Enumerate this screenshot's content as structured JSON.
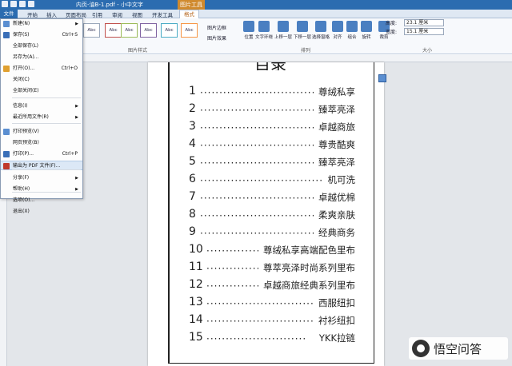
{
  "titlebar": {
    "doc_title": "内页-油B-1.pdf - 小中文字",
    "picture_tools": "图片工具"
  },
  "tabs": {
    "file": "文件",
    "start": "开始",
    "insert": "插入",
    "layout": "页面布局",
    "reference": "引用",
    "review": "审阅",
    "view": "视图",
    "developer": "开发工具",
    "format": "格式"
  },
  "ribbon": {
    "style_label": "Abc",
    "picture_border": "图片边框",
    "picture_effect": "图片效果",
    "group_picture_style": "图片样式",
    "position": "位置",
    "wrap_text": "文字环绕",
    "bring_forward": "上移一层",
    "send_backward": "下移一层",
    "selection_pane": "选择窗格",
    "align": "对齐",
    "group": "组合",
    "rotate": "旋转",
    "crop": "裁剪",
    "group_arrange": "排列",
    "height_label": "高度:",
    "height_value": "23.1 厘米",
    "width_label": "宽度:",
    "width_value": "15.1 厘米",
    "group_size": "大小"
  },
  "file_menu": {
    "items": [
      {
        "label": "新建(N)",
        "shortcut": "",
        "arrow": "▶"
      },
      {
        "label": "保存(S)",
        "shortcut": "Ctrl+S",
        "arrow": ""
      },
      {
        "label": "全部保存(L)",
        "shortcut": "",
        "arrow": ""
      },
      {
        "label": "另存为(A)...",
        "shortcut": "",
        "arrow": ""
      },
      {
        "label": "打开(O)...",
        "shortcut": "Ctrl+O",
        "arrow": ""
      },
      {
        "label": "关闭(C)",
        "shortcut": "",
        "arrow": ""
      },
      {
        "label": "全部关闭(E)",
        "shortcut": "",
        "arrow": ""
      },
      {
        "label": "信息(I)",
        "shortcut": "",
        "arrow": "▶"
      },
      {
        "label": "最近所用文件(R)",
        "shortcut": "",
        "arrow": "▶"
      },
      {
        "label": "打印预览(V)",
        "shortcut": "",
        "arrow": ""
      },
      {
        "label": "网页预览(B)",
        "shortcut": "",
        "arrow": ""
      },
      {
        "label": "打印(P)...",
        "shortcut": "Ctrl+P",
        "arrow": ""
      },
      {
        "label": "输出为 PDF 文件(F)...",
        "shortcut": "",
        "arrow": ""
      },
      {
        "label": "分享(F)",
        "shortcut": "",
        "arrow": "▶"
      },
      {
        "label": "帮助(H)",
        "shortcut": "",
        "arrow": "▶"
      },
      {
        "label": "选项(O)...",
        "shortcut": "",
        "arrow": ""
      },
      {
        "label": "退出(X)",
        "shortcut": "",
        "arrow": ""
      }
    ]
  },
  "document": {
    "title": "目录",
    "entries": [
      {
        "num": "1",
        "text": "尊绒私享"
      },
      {
        "num": "2",
        "text": "臻萃亮泽"
      },
      {
        "num": "3",
        "text": "卓越商旅"
      },
      {
        "num": "4",
        "text": "尊贵酷爽"
      },
      {
        "num": "5",
        "text": "臻萃亮泽"
      },
      {
        "num": "6",
        "text": "机可洗"
      },
      {
        "num": "7",
        "text": "卓越优棉"
      },
      {
        "num": "8",
        "text": "柔爽亲肤"
      },
      {
        "num": "9",
        "text": "经典商务"
      },
      {
        "num": "10",
        "text": "尊绒私享高端配色里布"
      },
      {
        "num": "11",
        "text": "尊萃亮泽时尚系列里布"
      },
      {
        "num": "12",
        "text": "卓越商旅经典系列里布"
      },
      {
        "num": "13",
        "text": "西服纽扣"
      },
      {
        "num": "14",
        "text": "衬衫纽扣"
      },
      {
        "num": "15",
        "text": "YKK拉链"
      }
    ]
  },
  "watermark": {
    "text": "悟空问答"
  },
  "colors": {
    "title_bar": "#2b6cb0",
    "tool_tab": "#d08a2e",
    "menu_highlight": "#dce8f6"
  }
}
